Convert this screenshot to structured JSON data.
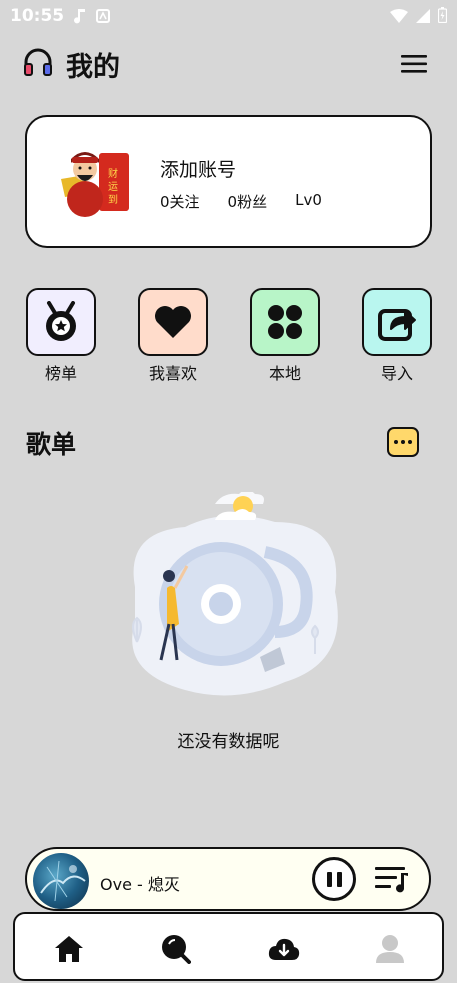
{
  "status_bar": {
    "time": "10:55"
  },
  "header": {
    "title": "我的"
  },
  "profile": {
    "name": "添加账号",
    "follows": "0关注",
    "fans": "0粉丝",
    "level": "Lv0"
  },
  "quick_actions": [
    {
      "label": "榜单",
      "icon": "medal-icon",
      "color": "#f1eefe"
    },
    {
      "label": "我喜欢",
      "icon": "heart-icon",
      "color": "#ffdccb"
    },
    {
      "label": "本地",
      "icon": "grid-icon",
      "color": "#b8f5c8"
    },
    {
      "label": "导入",
      "icon": "import-icon",
      "color": "#b9f6ef"
    }
  ],
  "playlist_section": {
    "title": "歌单",
    "empty_text": "还没有数据呢"
  },
  "player": {
    "song": "Ove - 熄灭"
  },
  "colors": {
    "background": "#d7d7d7",
    "more_button": "#ffd86b",
    "player_bg": "#fffff2"
  }
}
